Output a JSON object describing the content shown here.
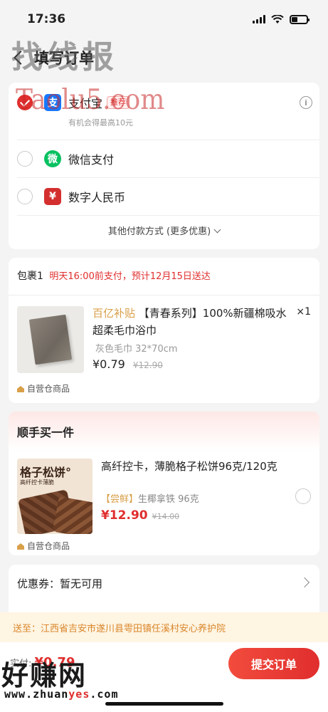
{
  "status_bar": {
    "time": "17:36",
    "battery_level": 0.4
  },
  "watermarks": {
    "top": "找线报",
    "red": "Taolu5.com",
    "bottom": "好赚网",
    "url_prefix": "www.zhuan",
    "url_highlight": "yes",
    "url_suffix": ".com"
  },
  "nav": {
    "title": "填写订单"
  },
  "payment": {
    "alipay": {
      "name": "支付宝",
      "badge": "推荐",
      "sub": "有机会得最高10元",
      "logo": "支",
      "checked": true
    },
    "wechat": {
      "name": "微信支付",
      "logo": "微",
      "checked": false
    },
    "ecny": {
      "name": "数字人民币",
      "logo": "¥",
      "checked": false
    },
    "more_label": "其他付款方式 (更多优惠)"
  },
  "package": {
    "label": "包裹1",
    "delivery_note": "明天16:00前支付，预计12月15日送达",
    "product": {
      "subsidy_tag": "百亿补贴",
      "title": "【青春系列】100%新疆棉吸水超柔毛巾浴巾",
      "qty": "×1",
      "spec": "灰色毛巾 32*70cm",
      "price": "¥0.79",
      "original_price": "¥12.90"
    },
    "self_operated": "自营仓商品"
  },
  "bundle": {
    "title": "顺手买一件",
    "image_title": "格子松饼°",
    "image_sub": "高纤控卡薄脆",
    "name": "高纤控卡，薄脆格子松饼96克/120克",
    "fresh_tag": "【尝鲜】",
    "sub": "生椰拿铁 96克",
    "price": "¥12.90",
    "original_price": "¥14.00",
    "self_operated": "自营仓商品"
  },
  "coupon": {
    "label": "优惠券：暂无可用"
  },
  "address": {
    "text": "送至：江西省吉安市遂川县雩田镇任溪村安心养护院"
  },
  "bottom": {
    "total_label": "实付:",
    "total_amount": "¥0.79",
    "submit_label": "提交订单"
  },
  "colors": {
    "accent": "#e02e2e",
    "subsidy": "#d9a04a",
    "alipay": "#1677ff",
    "wechat": "#07c160",
    "ecny": "#d32f2f"
  }
}
